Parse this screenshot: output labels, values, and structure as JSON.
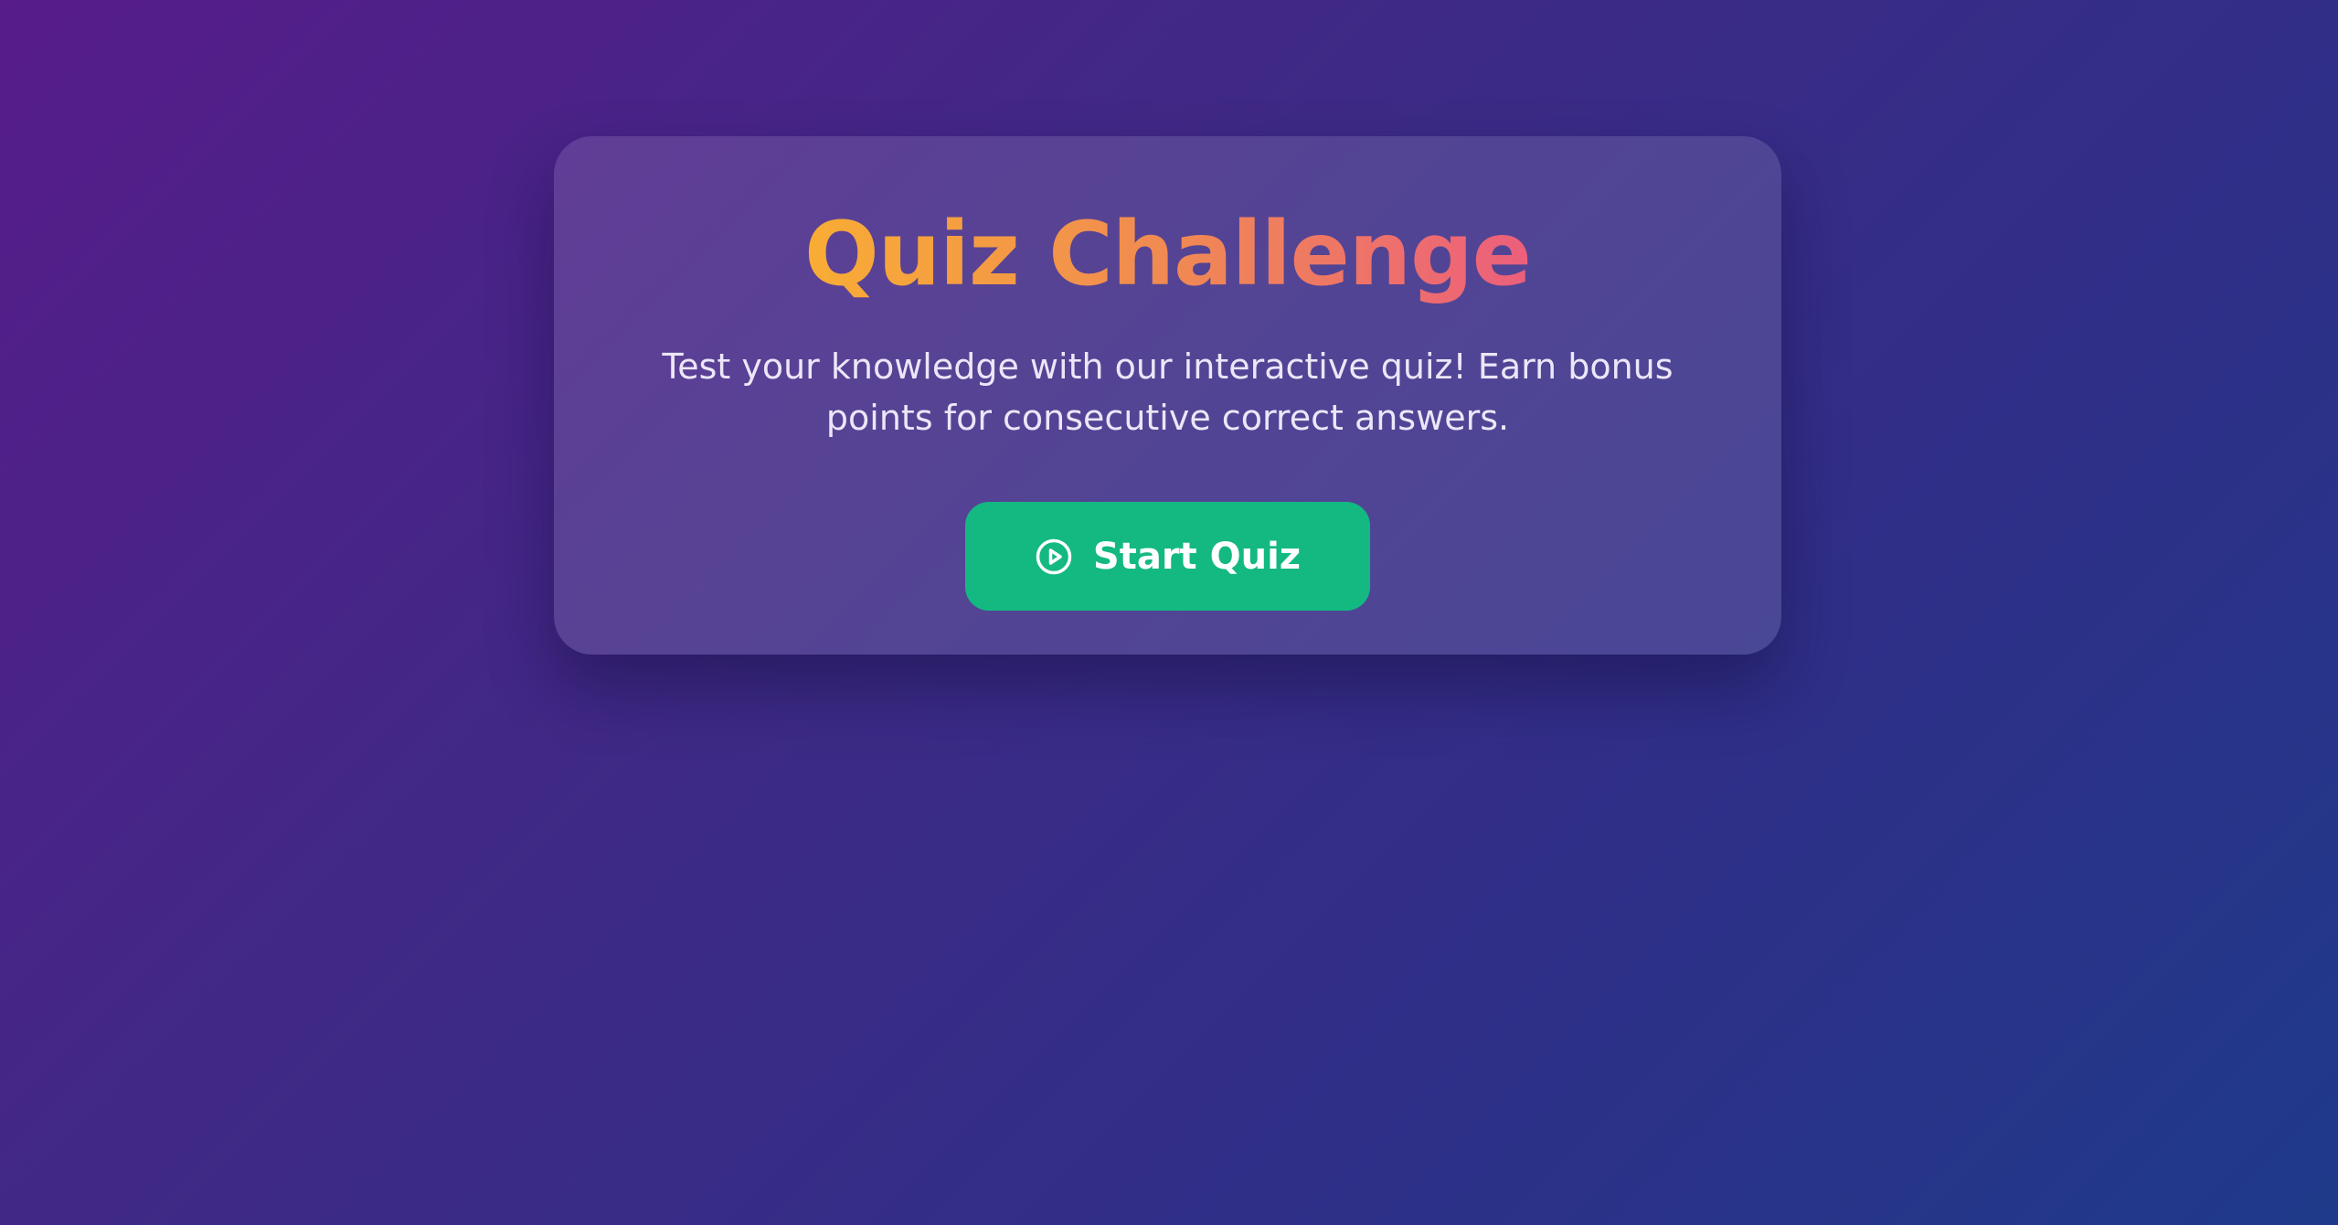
{
  "quiz": {
    "title": "Quiz Challenge",
    "description": "Test your knowledge with our interactive quiz! Earn bonus points for consecutive correct answers.",
    "start_button": {
      "label": "Start Quiz",
      "icon": "play-circle-icon"
    }
  },
  "colors": {
    "background_start": "#571c8a",
    "background_end": "#1f3a8a",
    "title_gradient_start": "#f8ad34",
    "title_gradient_end": "#ec5f7c",
    "button": "#13b981",
    "description_text": "#ece6f8"
  }
}
